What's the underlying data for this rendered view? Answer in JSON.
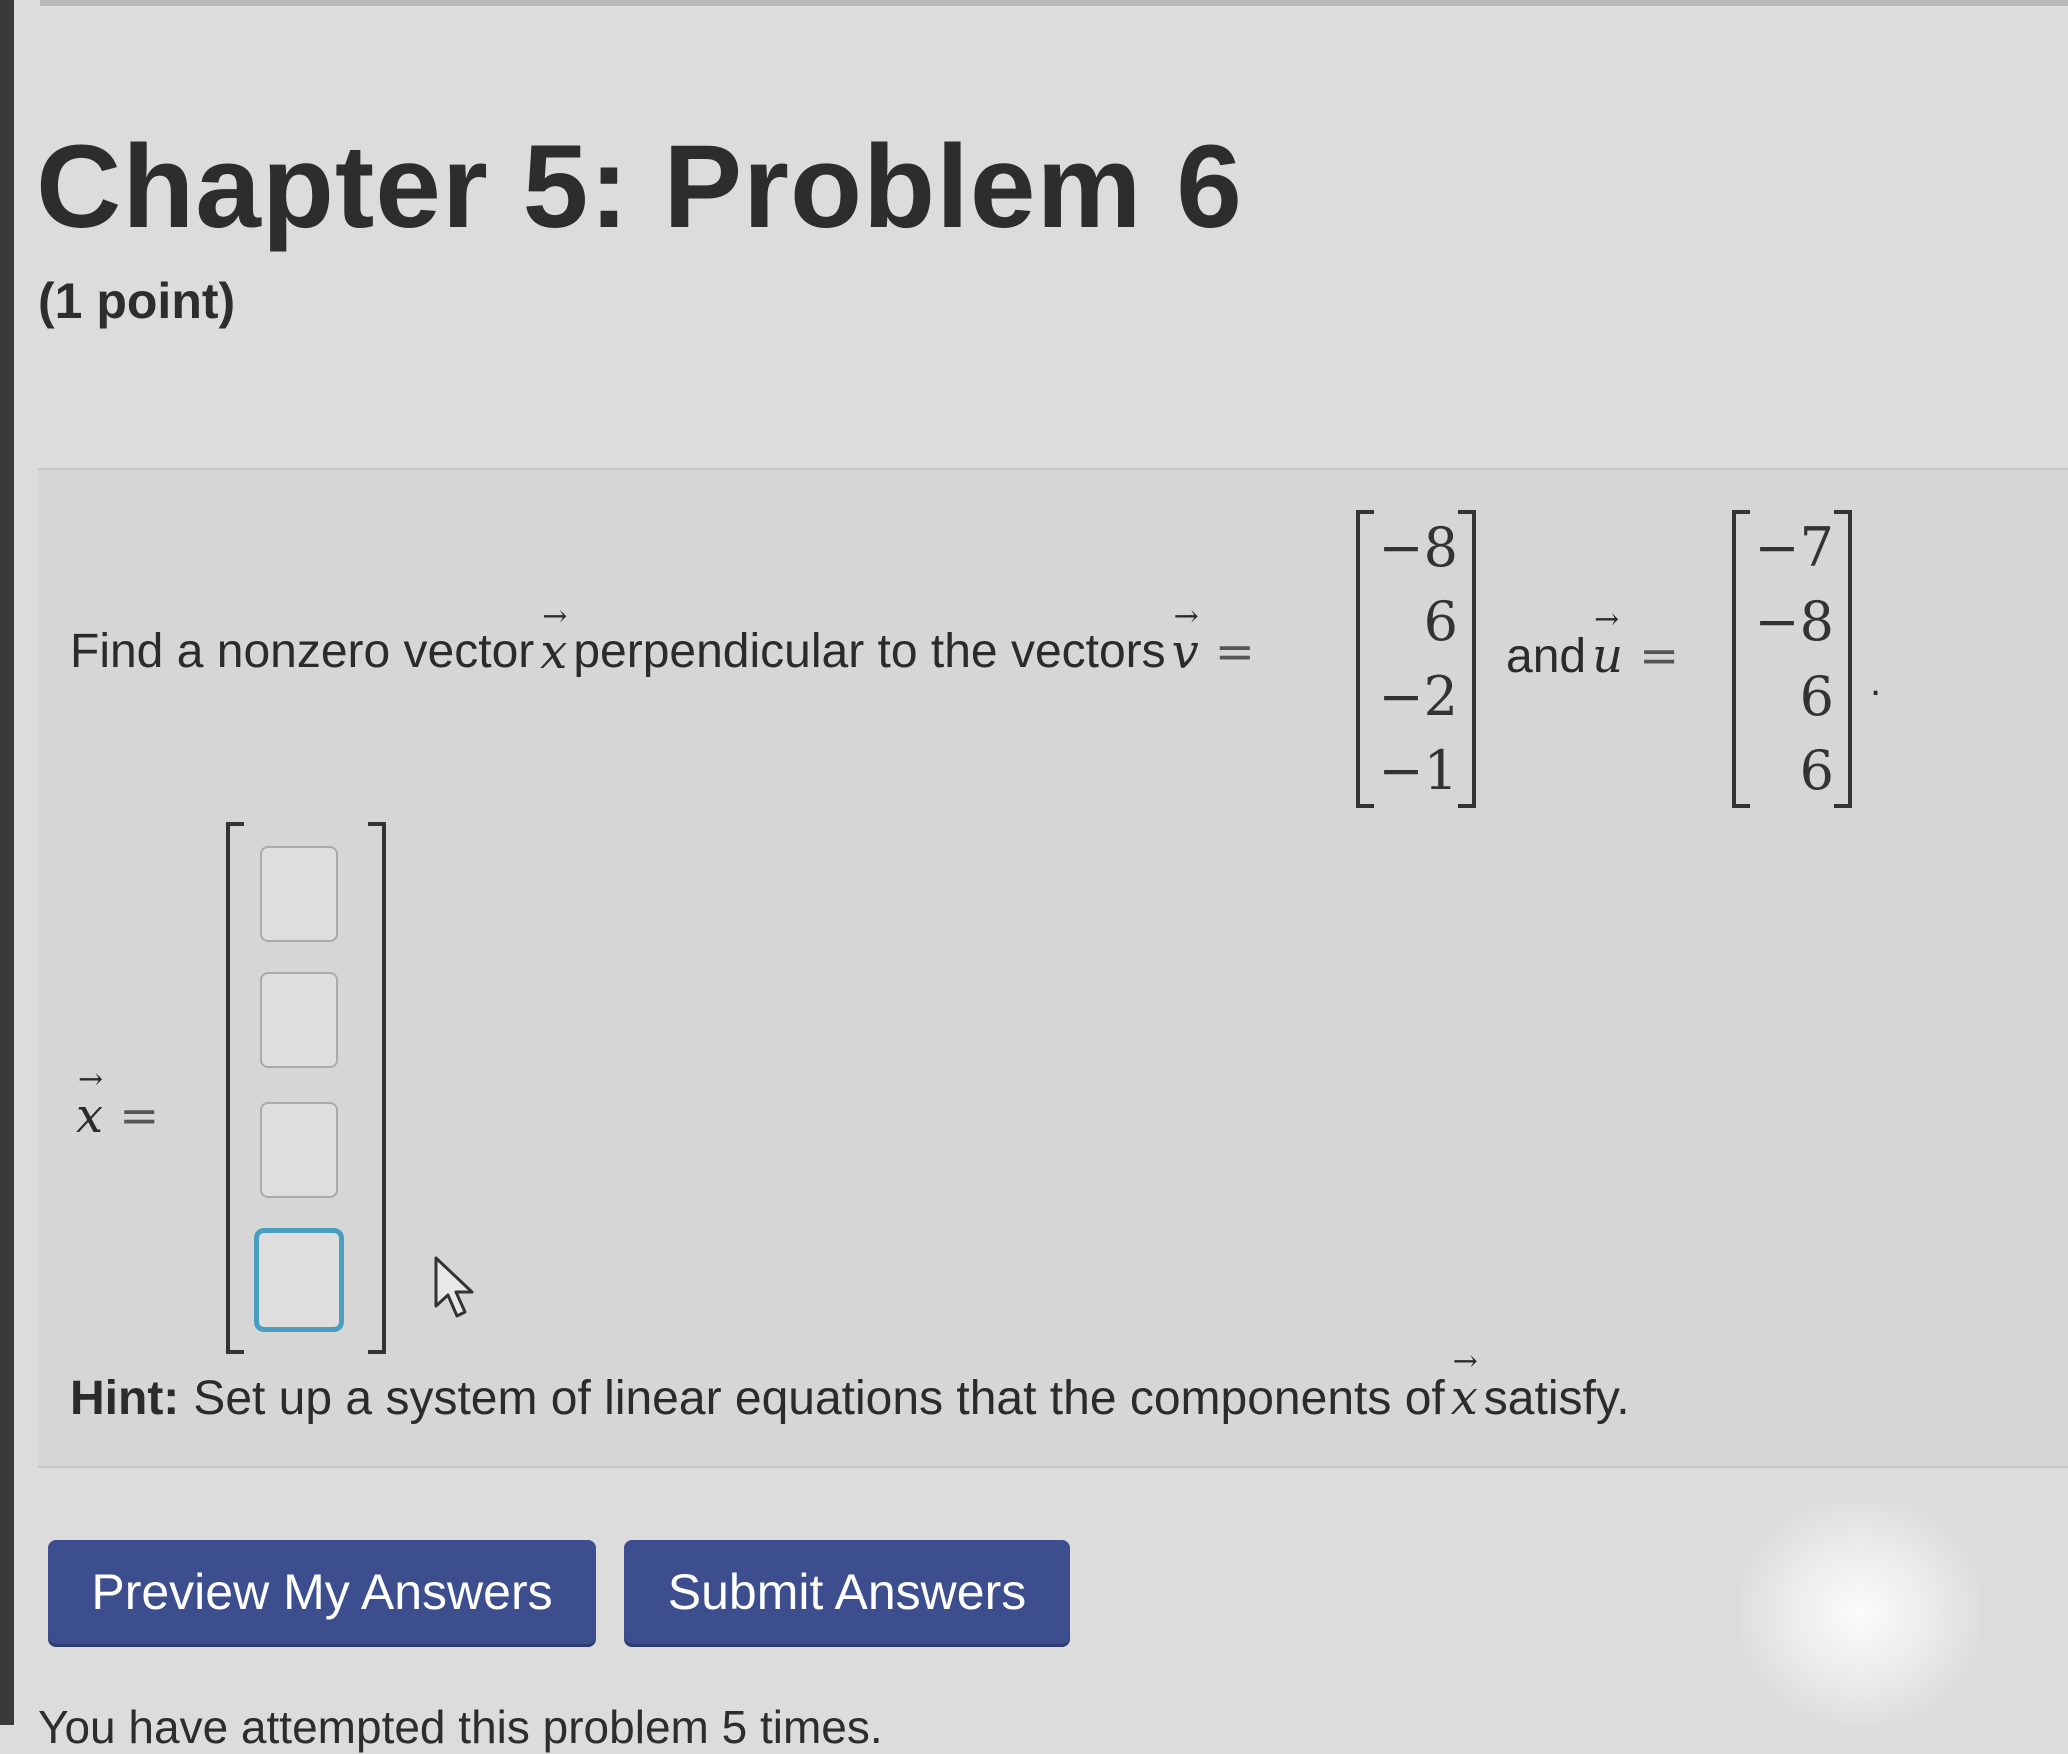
{
  "page": {
    "title": "Chapter 5: Problem 6",
    "points": "(1 point)"
  },
  "problem": {
    "statement_prefix": "Find a nonzero vector",
    "statement_middle": "perpendicular to the vectors",
    "and_text": "and",
    "period": ".",
    "symbol_x": "x",
    "symbol_v": "v",
    "symbol_u": "u",
    "arrow": "→",
    "equals": "=",
    "vector_v": [
      "−8",
      "6",
      "−2",
      "−1"
    ],
    "vector_u": [
      "−7",
      "−8",
      "6",
      "6"
    ],
    "answer_inputs": [
      "",
      "",
      "",
      ""
    ],
    "answer_focused_index": 3
  },
  "hint": {
    "label": "Hint:",
    "text_prefix": "Set up a system of linear equations that the components of",
    "text_suffix": "satisfy."
  },
  "buttons": {
    "preview": "Preview My Answers",
    "submit": "Submit Answers"
  },
  "footer": {
    "attempts_text": "You have attempted this problem 5 times."
  }
}
